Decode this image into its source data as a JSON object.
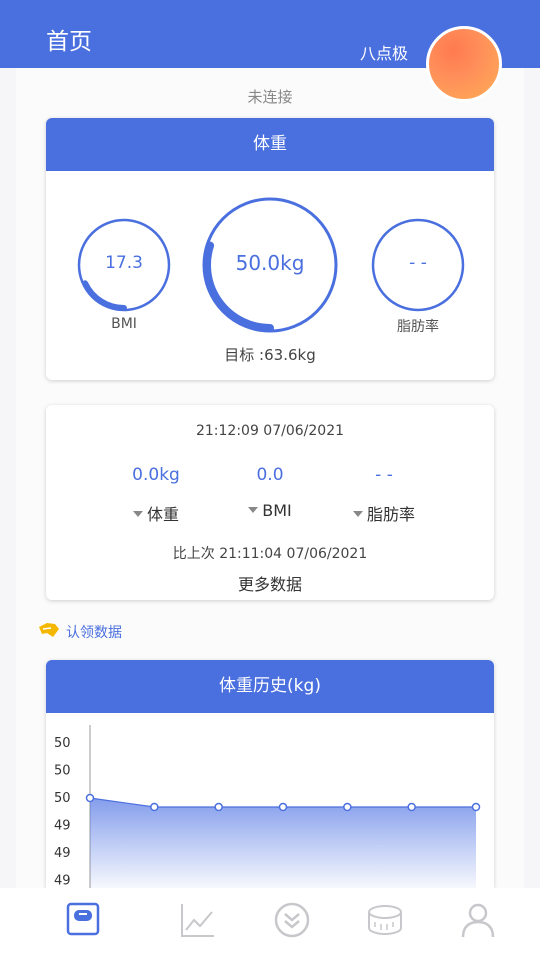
{
  "header": {
    "title": "首页",
    "username": "八点极"
  },
  "connection_status": "未连接",
  "weight_card": {
    "title": "体重",
    "bmi": {
      "value": "17.3",
      "label": "BMI",
      "fraction": 0.18
    },
    "weight": {
      "value": "50.0kg",
      "fraction": 0.3
    },
    "body_fat": {
      "value": "- -",
      "label": "脂肪率",
      "fraction": 0
    },
    "goal": "目标 :63.6kg"
  },
  "measurement_card": {
    "timestamp": "21:12:09  07/06/2021",
    "metrics": [
      {
        "value": "0.0kg",
        "label": "体重"
      },
      {
        "value": "0.0",
        "label": "BMI"
      },
      {
        "value": "- -",
        "label": "脂肪率"
      }
    ],
    "compare": "比上次  21:11:04  07/06/2021",
    "more": "更多数据"
  },
  "claim_data": {
    "label": "认领数据"
  },
  "history_card": {
    "title": "体重历史(kg)",
    "chart_data": {
      "type": "area",
      "title": "体重历史(kg)",
      "y_tick_labels": [
        "50",
        "50",
        "50",
        "49",
        "49",
        "49"
      ],
      "values": [
        50.0,
        49.9,
        49.9,
        49.9,
        49.9,
        49.9,
        49.9
      ],
      "grid": false
    }
  },
  "bottom_nav": {
    "items": [
      {
        "icon": "scale-icon",
        "active": true
      },
      {
        "icon": "trend-chart-icon",
        "active": false
      },
      {
        "icon": "double-chevron-down-icon",
        "active": false
      },
      {
        "icon": "tape-measure-icon",
        "active": false
      },
      {
        "icon": "user-icon",
        "active": false
      }
    ]
  },
  "colors": {
    "accent": "#4a6fdf",
    "avatar": "#ff8a55",
    "claim_icon": "#f5b800"
  }
}
